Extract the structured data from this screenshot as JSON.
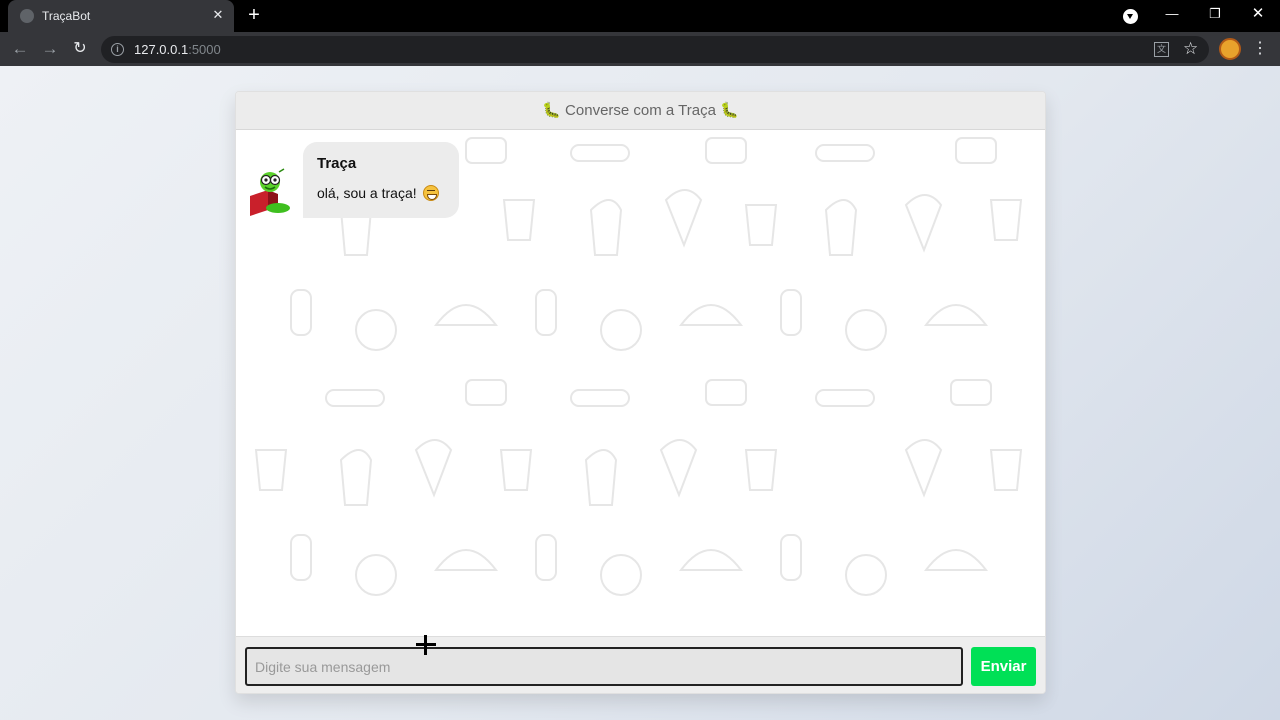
{
  "browser": {
    "tab_title": "TraçaBot",
    "tab_close": "✕",
    "new_tab": "+",
    "url_host": "127.0.0.1",
    "url_port": ":5000",
    "window_min": "—",
    "window_max": "❐",
    "window_close": "✕",
    "back": "←",
    "forward": "→",
    "reload": "↻",
    "star": "☆",
    "menu": "⋮",
    "translate": "文",
    "info": "i"
  },
  "chat": {
    "header_title": "🐛 Converse com a Traça 🐛",
    "messages": [
      {
        "sender": "Traça",
        "text": "olá, sou a traça!",
        "emoji": "grinning-face",
        "avatar": "bookworm-avatar"
      }
    ],
    "input_placeholder": "Digite sua mensagem",
    "input_value": "",
    "send_label": "Enviar"
  },
  "colors": {
    "send_button": "#00e056",
    "header_bg": "#ececec",
    "bubble_bg": "#ececec",
    "footer_bg": "#eeeeee"
  }
}
